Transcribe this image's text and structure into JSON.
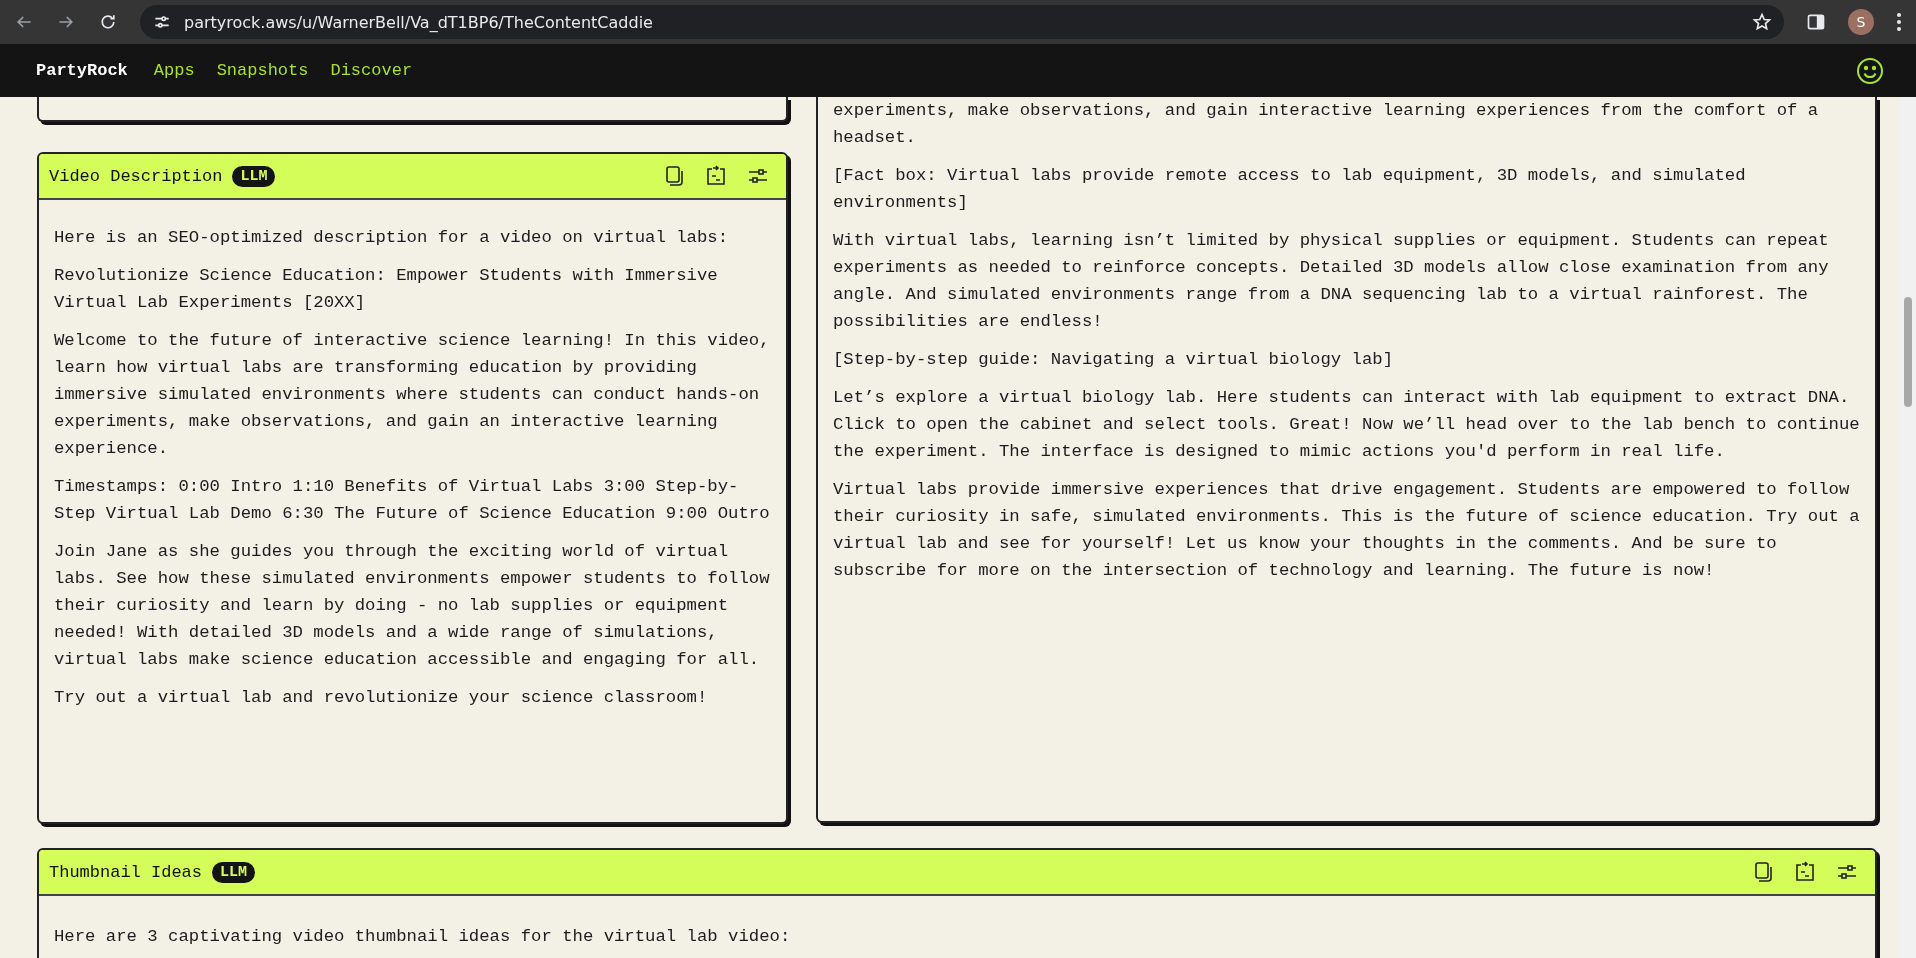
{
  "browser": {
    "url": "partyrock.aws/u/WarnerBell/Va_dT1BP6/TheContentCaddie",
    "avatar": "S"
  },
  "nav": {
    "brand": "PartyRock",
    "links": [
      "Apps",
      "Snapshots",
      "Discover"
    ]
  },
  "left_cards": [
    {
      "title": "Video Description",
      "badge": "LLM",
      "paragraphs": [
        "Here is an SEO-optimized description for a video on virtual labs:",
        "Revolutionize Science Education: Empower Students with Immersive Virtual Lab Experiments [20XX]",
        "Welcome to the future of interactive science learning! In this video, learn how virtual labs are transforming education by providing immersive simulated environments where students can conduct hands-on experiments, make observations, and gain an interactive learning experience.",
        "Timestamps: 0:00 Intro 1:10 Benefits of Virtual Labs 3:00 Step-by-Step Virtual Lab Demo 6:30 The Future of Science Education 9:00 Outro",
        "Join Jane as she guides you through the exciting world of virtual labs. See how these simulated environments empower students to follow their curiosity and learn by doing - no lab supplies or equipment needed! With detailed 3D models and a wide range of simulations, virtual labs make science education accessible and engaging for all.",
        "Try out a virtual lab and revolutionize your science classroom!"
      ]
    }
  ],
  "right_card": {
    "paragraphs": [
      "experiments, make observations, and gain interactive learning experiences from the comfort of a headset.",
      "[Fact box: Virtual labs provide remote access to lab equipment, 3D models, and simulated environments]",
      "With virtual labs, learning isn’t limited by physical supplies or equipment. Students can repeat experiments as needed to reinforce concepts. Detailed 3D models allow close examination from any angle. And simulated environments range from a DNA sequencing lab to a virtual rainforest. The possibilities are endless!",
      "[Step-by-step guide: Navigating a virtual biology lab]",
      "Let’s explore a virtual biology lab. Here students can interact with lab equipment to extract DNA. Click to open the cabinet and select tools. Great! Now we’ll head over to the lab bench to continue the experiment. The interface is designed to mimic actions you'd perform in real life.",
      "Virtual labs provide immersive experiences that drive engagement. Students are empowered to follow their curiosity in safe, simulated environments. This is the future of science education. Try out a virtual lab and see for yourself! Let us know your thoughts in the comments. And be sure to subscribe for more on the intersection of technology and learning. The future is now!"
    ]
  },
  "bottom_card": {
    "title": "Thumbnail Ideas",
    "badge": "LLM",
    "paragraphs": [
      "Here are 3 captivating video thumbnail ideas for the virtual lab video:"
    ]
  }
}
